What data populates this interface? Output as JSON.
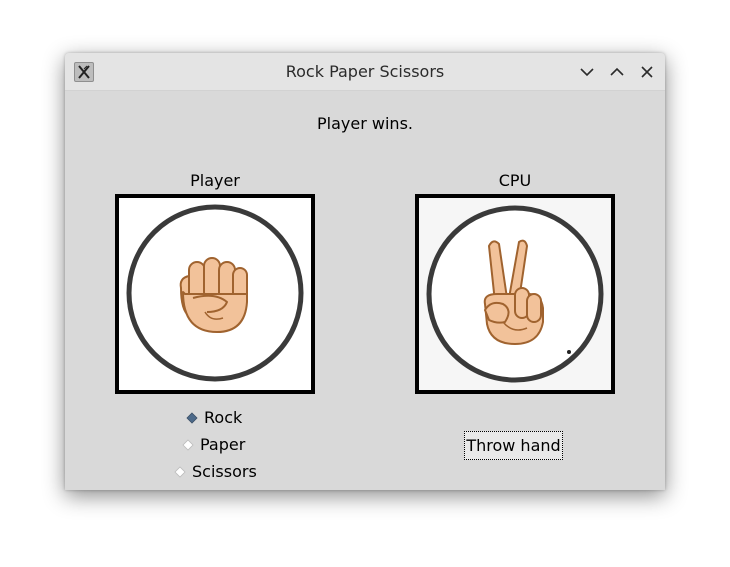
{
  "window": {
    "title": "Rock Paper Scissors",
    "app_icon": "x11-icon",
    "controls": {
      "minimize_icon": "chevron-down-icon",
      "maximize_icon": "chevron-up-icon",
      "close_icon": "close-icon"
    }
  },
  "status": "Player wins.",
  "player": {
    "label": "Player",
    "hand_icon": "fist-rock-icon",
    "choices": [
      {
        "label": "Rock",
        "selected": true
      },
      {
        "label": "Paper",
        "selected": false
      },
      {
        "label": "Scissors",
        "selected": false
      }
    ]
  },
  "cpu": {
    "label": "CPU",
    "hand_icon": "peace-scissors-icon",
    "throw_button": "Throw hand"
  },
  "colors": {
    "window_bg": "#d9d9d9",
    "titlebar_bg": "#e4e4e4",
    "skin": "#f2c29a",
    "skin_outline": "#a0632f",
    "selected_radio": "#4d6a8a"
  }
}
